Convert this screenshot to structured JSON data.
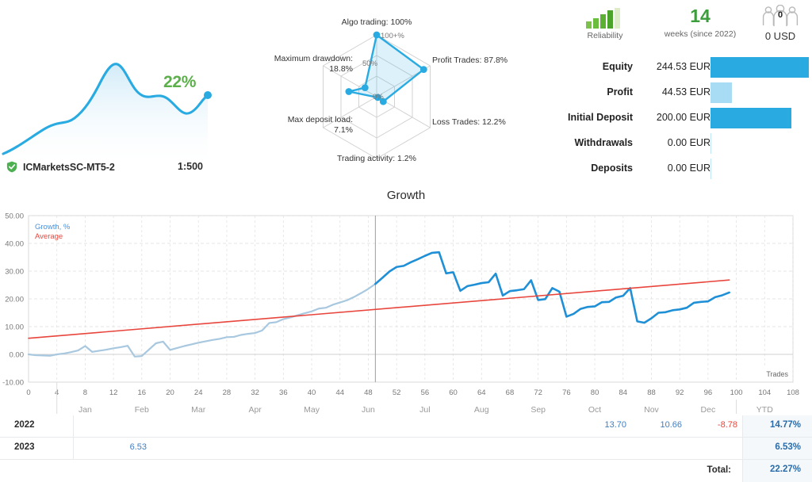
{
  "account": {
    "sparkline_percent": "22%",
    "verified_icon": "shield-check-icon",
    "broker": "ICMarketsSC-MT5-2",
    "leverage": "1:500",
    "sparkline_color": "#29abe2",
    "percent_color": "#5bb04a"
  },
  "radar": {
    "inner_labels": [
      "100+%",
      "50%",
      "0%"
    ],
    "axes": [
      {
        "key": "algo_trading",
        "label": "Algo trading: 100%",
        "value": 100,
        "pos": "top"
      },
      {
        "key": "profit_trades",
        "label": "Profit Trades: 87.8%",
        "value": 87.8,
        "pos": "upper-right"
      },
      {
        "key": "loss_trades",
        "label": "Loss Trades: 12.2%",
        "value": 12.2,
        "pos": "lower-right"
      },
      {
        "key": "trading_activity",
        "label": "Trading activity: 1.2%",
        "value": 1.2,
        "pos": "bottom"
      },
      {
        "key": "max_deposit_load",
        "label": "Max deposit load:\n7.1%",
        "value": 7.1,
        "pos": "lower-left"
      },
      {
        "key": "max_drawdown",
        "label": "Maximum drawdown:\n18.8%",
        "value": 18.8,
        "pos": "upper-left"
      }
    ]
  },
  "kpis": {
    "reliability": {
      "icon": "reliability-bars-icon",
      "caption": "Reliability",
      "bars_filled": 4,
      "bars_total": 5
    },
    "age": {
      "value": "14",
      "caption": "weeks (since 2022)"
    },
    "subscribers": {
      "icon": "people-icon",
      "count": "0",
      "value": "0 USD"
    }
  },
  "balance_rows": [
    {
      "label": "Equity",
      "value": "244.53 EUR",
      "bar_pct": 100,
      "bar_color": "#29abe2"
    },
    {
      "label": "Profit",
      "value": "44.53 EUR",
      "bar_pct": 22,
      "bar_color": "#a8dcf5"
    },
    {
      "label": "Initial Deposit",
      "value": "200.00 EUR",
      "bar_pct": 82,
      "bar_color": "#29abe2"
    },
    {
      "label": "Withdrawals",
      "value": "0.00 EUR",
      "bar_pct": 0,
      "bar_color": "#29abe2"
    },
    {
      "label": "Deposits",
      "value": "0.00 EUR",
      "bar_pct": 0,
      "bar_color": "#29abe2"
    }
  ],
  "chart_data": {
    "type": "line",
    "title": "Growth",
    "xlabel": "Trades",
    "ylabel": "",
    "xlim": [
      0,
      108
    ],
    "ylim": [
      -10,
      50
    ],
    "xticks": [
      0,
      4,
      8,
      12,
      16,
      20,
      24,
      28,
      32,
      36,
      40,
      44,
      48,
      52,
      56,
      60,
      64,
      68,
      72,
      76,
      80,
      84,
      88,
      92,
      96,
      100,
      104,
      108
    ],
    "yticks": [
      -10.0,
      0.0,
      10.0,
      20.0,
      30.0,
      40.0,
      50.0
    ],
    "ytick_labels": [
      "-10.00",
      "0.00",
      "10.00",
      "20.00",
      "30.00",
      "40.00",
      "50.00"
    ],
    "month_labels": [
      "Jan",
      "Feb",
      "Mar",
      "Apr",
      "May",
      "Jun",
      "Jul",
      "Aug",
      "Sep",
      "Oct",
      "Nov",
      "Dec",
      "YTD"
    ],
    "grid": true,
    "legend_position": "top-left",
    "series": [
      {
        "name": "Growth, %",
        "color": "#1f8fd6",
        "past_color": "#a8c8e0",
        "split_x": 49,
        "points": [
          [
            0,
            0.0
          ],
          [
            1,
            -0.3
          ],
          [
            2,
            -0.4
          ],
          [
            3,
            -0.5
          ],
          [
            4,
            0.0
          ],
          [
            5,
            0.3
          ],
          [
            6,
            0.8
          ],
          [
            7,
            1.4
          ],
          [
            8,
            3.0
          ],
          [
            9,
            0.9
          ],
          [
            10,
            1.3
          ],
          [
            11,
            1.7
          ],
          [
            12,
            2.2
          ],
          [
            13,
            2.6
          ],
          [
            14,
            3.1
          ],
          [
            15,
            -0.8
          ],
          [
            16,
            -0.6
          ],
          [
            17,
            1.7
          ],
          [
            18,
            4.0
          ],
          [
            19,
            4.6
          ],
          [
            20,
            1.6
          ],
          [
            21,
            2.3
          ],
          [
            22,
            3.0
          ],
          [
            23,
            3.6
          ],
          [
            24,
            4.2
          ],
          [
            25,
            4.7
          ],
          [
            26,
            5.2
          ],
          [
            27,
            5.6
          ],
          [
            28,
            6.2
          ],
          [
            29,
            6.3
          ],
          [
            30,
            7.0
          ],
          [
            31,
            7.4
          ],
          [
            32,
            7.7
          ],
          [
            33,
            8.6
          ],
          [
            34,
            11.3
          ],
          [
            35,
            11.6
          ],
          [
            36,
            12.7
          ],
          [
            37,
            13.3
          ],
          [
            38,
            14.1
          ],
          [
            39,
            14.8
          ],
          [
            40,
            15.5
          ],
          [
            41,
            16.5
          ],
          [
            42,
            16.8
          ],
          [
            43,
            17.9
          ],
          [
            44,
            18.7
          ],
          [
            45,
            19.5
          ],
          [
            46,
            20.7
          ],
          [
            47,
            22.1
          ],
          [
            48,
            23.6
          ],
          [
            49,
            25.4
          ],
          [
            50,
            27.6
          ],
          [
            51,
            29.9
          ],
          [
            52,
            31.5
          ],
          [
            53,
            31.9
          ],
          [
            54,
            33.2
          ],
          [
            55,
            34.3
          ],
          [
            56,
            35.5
          ],
          [
            57,
            36.6
          ],
          [
            58,
            36.8
          ],
          [
            59,
            29.2
          ],
          [
            60,
            29.6
          ],
          [
            61,
            22.9
          ],
          [
            62,
            24.6
          ],
          [
            63,
            25.1
          ],
          [
            64,
            25.7
          ],
          [
            65,
            26.0
          ],
          [
            66,
            29.1
          ],
          [
            67,
            21.2
          ],
          [
            68,
            22.8
          ],
          [
            69,
            23.1
          ],
          [
            70,
            23.5
          ],
          [
            71,
            26.7
          ],
          [
            72,
            19.6
          ],
          [
            73,
            19.9
          ],
          [
            74,
            23.9
          ],
          [
            75,
            22.6
          ],
          [
            76,
            13.6
          ],
          [
            77,
            14.6
          ],
          [
            78,
            16.4
          ],
          [
            79,
            17.1
          ],
          [
            80,
            17.3
          ],
          [
            81,
            18.8
          ],
          [
            82,
            18.9
          ],
          [
            83,
            20.5
          ],
          [
            84,
            21.1
          ],
          [
            85,
            23.9
          ],
          [
            86,
            11.9
          ],
          [
            87,
            11.4
          ],
          [
            88,
            13.0
          ],
          [
            89,
            15.0
          ],
          [
            90,
            15.2
          ],
          [
            91,
            15.9
          ],
          [
            92,
            16.2
          ],
          [
            93,
            16.8
          ],
          [
            94,
            18.6
          ],
          [
            95,
            18.9
          ],
          [
            96,
            19.1
          ],
          [
            97,
            20.6
          ],
          [
            98,
            21.3
          ],
          [
            99,
            22.3
          ]
        ]
      },
      {
        "name": "Average",
        "color": "#e8453c",
        "points": [
          [
            0,
            5.8
          ],
          [
            99,
            26.8
          ]
        ]
      }
    ]
  },
  "year_table": {
    "months": [
      "Jan",
      "Feb",
      "Mar",
      "Apr",
      "May",
      "Jun",
      "Jul",
      "Aug",
      "Sep",
      "Oct",
      "Nov",
      "Dec"
    ],
    "ytd_header": "YTD",
    "total_label": "Total:",
    "total_value": "22.27%",
    "rows": [
      {
        "year": "2022",
        "values": {
          "Oct": "13.70",
          "Nov": "10.66",
          "Dec": "-8.78"
        },
        "negatives": [
          "Dec"
        ],
        "ytd": "14.77%"
      },
      {
        "year": "2023",
        "values": {
          "Jan": "6.53"
        },
        "negatives": [],
        "ytd": "6.53%"
      }
    ]
  }
}
